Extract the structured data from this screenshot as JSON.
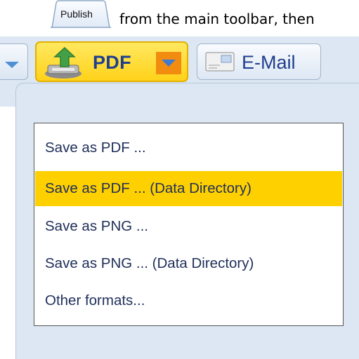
{
  "instruction": {
    "publish_tab_label": "Publish",
    "trailing_text": "from the main toolbar, then"
  },
  "toolbar": {
    "pdf_label": "PDF",
    "email_label": "E-Mail"
  },
  "menu": {
    "items": [
      {
        "label": "Save as PDF ...",
        "highlighted": false
      },
      {
        "label": "Save as PDF ... (Data Directory)",
        "highlighted": true
      },
      {
        "label": "Save as PNG ...",
        "highlighted": false
      },
      {
        "label": "Save as PNG ... (Data Directory)",
        "highlighted": false
      },
      {
        "label": "Other formats...",
        "highlighted": false
      }
    ]
  },
  "colors": {
    "highlight": "#ffd000",
    "pdf_button": "#ffd21a",
    "dropdown_arrow_box": "#f28c10",
    "toolbar_bg": "#dde7f3",
    "label_blue": "#1f3f8e"
  }
}
